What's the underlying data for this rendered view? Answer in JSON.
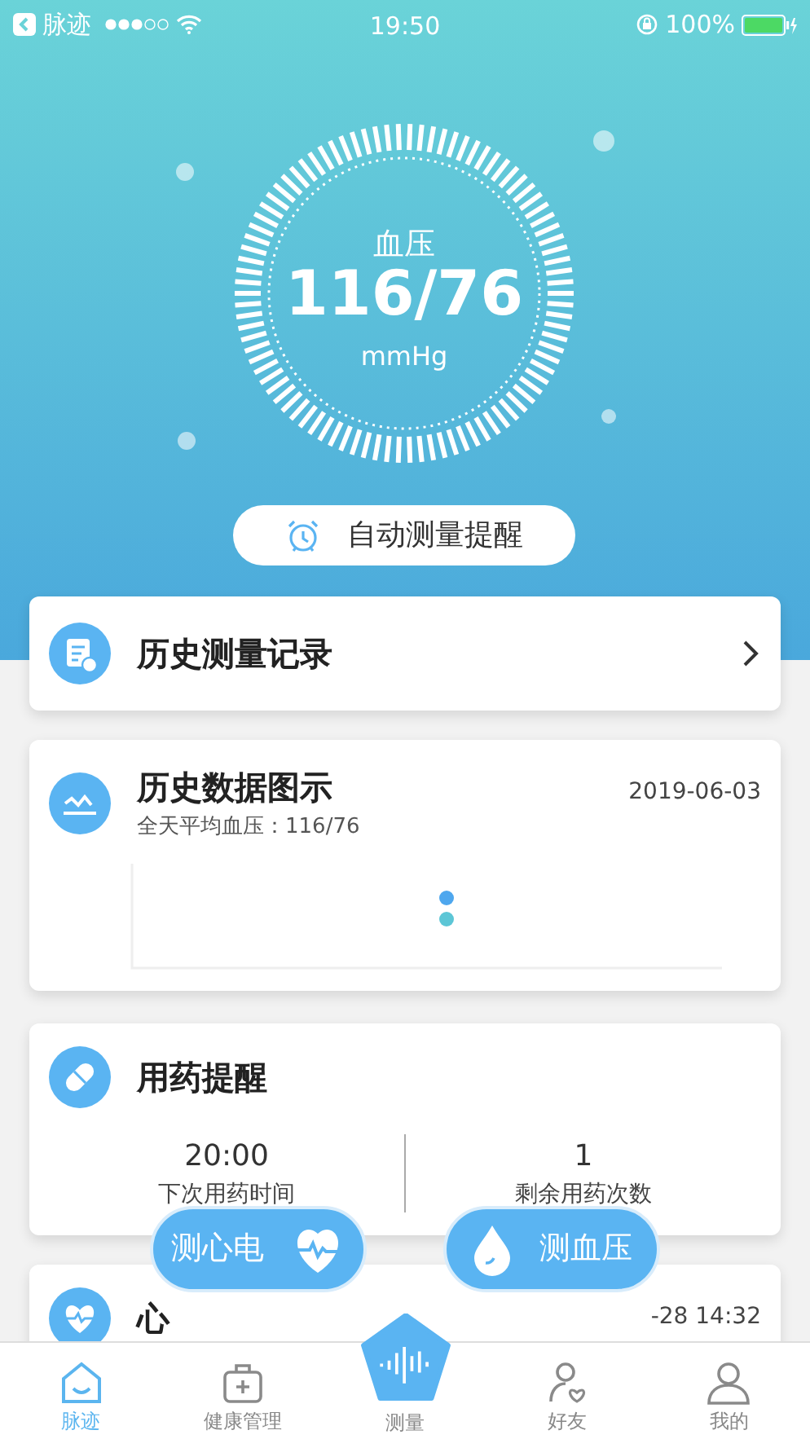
{
  "status_bar": {
    "back_label": "脉迹",
    "time": "19:50",
    "battery": "100%"
  },
  "header": {
    "measure_label": "血压",
    "reading": "116/76",
    "unit": "mmHg",
    "reminder_button": "自动测量提醒"
  },
  "cards": [
    {
      "kind": "link",
      "title": "历史测量记录"
    },
    {
      "kind": "chart",
      "title": "历史数据图示",
      "subtitle": "全天平均血压：116/76",
      "date": "2019-06-03"
    },
    {
      "kind": "medication",
      "title": "用药提醒",
      "stats": [
        {
          "value": "20:00",
          "label": "下次用药时间"
        },
        {
          "value": "1",
          "label": "剩余用药次数"
        }
      ]
    },
    {
      "kind": "ecg",
      "title": "心",
      "date": "-28 14:32"
    }
  ],
  "quick_actions": [
    {
      "kind": "ecg",
      "label": "测心电"
    },
    {
      "kind": "bp",
      "label": "测血压"
    }
  ],
  "tabs": [
    {
      "kind": "home",
      "label": "脉迹",
      "selected": true
    },
    {
      "kind": "health",
      "label": "健康管理",
      "selected": false
    },
    {
      "kind": "measure",
      "label": "测量",
      "selected": false
    },
    {
      "kind": "friends",
      "label": "好友",
      "selected": false
    },
    {
      "kind": "me",
      "label": "我的",
      "selected": false
    }
  ]
}
